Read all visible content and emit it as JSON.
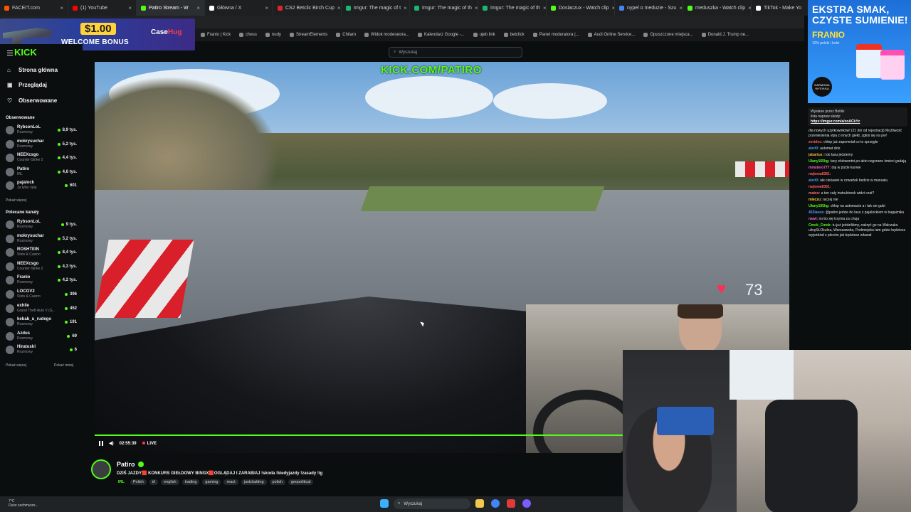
{
  "browser": {
    "tabs": [
      {
        "label": "FACEIT.com",
        "color": "#ff5500"
      },
      {
        "label": "(1) YouTube",
        "color": "#ff0000"
      },
      {
        "label": "Patiro Stream - W",
        "color": "#53fc18",
        "active": true
      },
      {
        "label": "Główna / X",
        "color": "#ffffff"
      },
      {
        "label": "CS2 Betclic Birch Cup",
        "color": "#e0242c"
      },
      {
        "label": "Imgur: The magic of t",
        "color": "#1bb76e"
      },
      {
        "label": "Imgur: The magic of th",
        "color": "#1bb76e"
      },
      {
        "label": "Imgur: The magic of th",
        "color": "#1bb76e"
      },
      {
        "label": "Dosiaczux - Watch clip",
        "color": "#53fc18"
      },
      {
        "label": "nypel o meduzie - Szu",
        "color": "#4285f4"
      },
      {
        "label": "meduszka - Watch clip",
        "color": "#53fc18"
      },
      {
        "label": "TikTok - Make Yo",
        "color": "#ffffff"
      }
    ],
    "bookmarks": [
      "Franio | Kick",
      "chess",
      "nudy",
      "StreamElements",
      "Chilam",
      "Widok moderatora...",
      "Kalendarz Google -...",
      "ujeb link",
      "betclick",
      "Panel moderatora |...",
      "Audi Online Service...",
      "Opuszczone miejsca...",
      "Donald J. Trump ne..."
    ]
  },
  "promo": {
    "amount": "$1.00",
    "text": "WELCOME BONUS",
    "brand_a": "Case",
    "brand_b": "Hug"
  },
  "ad": {
    "headline": "EKSTRA SMAK, CZYSTE SUMIENIE!",
    "brand": "FRANIO",
    "fine_print": "10% polski i lodzi",
    "badge": "DARMOWA WYSYŁKA"
  },
  "kick": {
    "logo": "KICK",
    "search_placeholder": "Wyszukaj"
  },
  "sidebar": {
    "nav": [
      {
        "label": "Strona główna",
        "icon": "⌂"
      },
      {
        "label": "Przeglądaj",
        "icon": "▣"
      },
      {
        "label": "Obserwowane",
        "icon": "♡"
      }
    ],
    "followed_title": "Obserwowane",
    "followed": [
      {
        "name": "RybsonLoL",
        "category": "Rozmowy",
        "viewers": "8,9 tys."
      },
      {
        "name": "mokrysuchar",
        "category": "Rozmowy",
        "viewers": "5,2 tys."
      },
      {
        "name": "NEEXcsgo",
        "category": "Counter-Strike 2",
        "viewers": "4,4 tys."
      },
      {
        "name": "Patiro",
        "category": "IRL",
        "viewers": "4,6 tys."
      },
      {
        "name": "pajalock",
        "category": "Ja tylko śpię",
        "viewers": "601"
      }
    ],
    "show_more": "Pokaż więcej",
    "recommended_title": "Polecane kanały",
    "recommended": [
      {
        "name": "RybsonLoL",
        "category": "Rozmowy",
        "viewers": "9 tys."
      },
      {
        "name": "mokrysuchar",
        "category": "Rozmowy",
        "viewers": "5,2 tys."
      },
      {
        "name": "ROSHTEIN",
        "category": "Slots & Casino",
        "viewers": "8,4 tys."
      },
      {
        "name": "NEEXcsgo",
        "category": "Counter-Strike 2",
        "viewers": "4,3 tys."
      },
      {
        "name": "Franio",
        "category": "Rozmowy",
        "viewers": "4,2 tys."
      },
      {
        "name": "LOCOV2",
        "category": "Slots & Casino",
        "viewers": "396"
      },
      {
        "name": "exhile",
        "category": "Grand Theft Auto V (G...",
        "viewers": "452"
      },
      {
        "name": "kebab_u_rudego",
        "category": "Rozmowy",
        "viewers": "191"
      },
      {
        "name": "Azdus",
        "category": "Rozmowy",
        "viewers": "69"
      },
      {
        "name": "Hiratoshi",
        "category": "Rozmowy",
        "viewers": "6"
      }
    ],
    "show_more_2": "Pokaż więcej",
    "show_less": "Pokaż mniej"
  },
  "player": {
    "watermark": "KICK.COM/PATIRO",
    "heart_rate": "73",
    "time": "02:55:39",
    "live": "LIVE",
    "progress": 0.76
  },
  "stream": {
    "name": "Patiro",
    "title": "DZIŚ JAZDY🟥 KONKURS GIEŁDOWY BINGX🟥OGLĄDAJ I ZARABIAJ !skoda !kiedyjazdy !zasady !ig",
    "category": "IRL",
    "tags": [
      "Polish",
      "irl",
      "english",
      "trading",
      "gaming",
      "react",
      "justchatting",
      "polish",
      "geopolitical"
    ]
  },
  "chat": {
    "pinned_by": "Wysłane przez Botilix",
    "pinned_text": "lista napraw skody:",
    "pinned_link": "https://imgur.com/a/xoACkYc",
    "messages": [
      {
        "user": "",
        "text": "dla nowych użytkowników! (21 dni od rejestracji) Możliwość przeniesienia vipa z innych giełd, zgłoś się na pw!",
        "color": "#dfe2e4"
      },
      {
        "user": "zortdoc:",
        "text": "chłop już zapomniał co to sprzęgło",
        "color": "#ff5c5c"
      },
      {
        "user": "alxri0:",
        "text": "automat dzis",
        "color": "#4aa3ff"
      },
      {
        "user": "jabartus:",
        "text": "i do lasu jedziemy",
        "color": "#ffb347"
      },
      {
        "user": "Ulany165kg:",
        "text": "tacy elokwentni po akto nagrzane śmieci gadają",
        "color": "#53fc18"
      },
      {
        "user": "mmstero777:",
        "text": "daj w pizde kurwie",
        "color": "#ff66cc"
      },
      {
        "user": "najtowa8381:",
        "text": "",
        "color": "#ff5c5c"
      },
      {
        "user": "alxri0:",
        "text": "ale ciekawie w czwartek bedzie w manualu",
        "color": "#4aa3ff"
      },
      {
        "user": "najtowa8381:",
        "text": "",
        "color": "#ff5c5c"
      },
      {
        "user": "mateo:",
        "text": "a ten cały instruktorek widzi czat?",
        "color": "#ff6e6e"
      },
      {
        "user": "mleczu:",
        "text": "raczej nie",
        "color": "#ffd23a"
      },
      {
        "user": "Ulany165kg:",
        "text": "chłop na automacie a i tak sie gubi",
        "color": "#53fc18"
      },
      {
        "user": "453laves:",
        "text": "@patiro jedzie do lasu z pajalockiem w bagażniku",
        "color": "#4aa3ff"
      },
      {
        "user": "nawt:",
        "text": "no bo się trzyma za chuja",
        "color": "#ff66cc"
      },
      {
        "user": "Cmok_Cmok:",
        "text": "tu już jeździliśmy, nakręć go na Walczaka ulicęSŁOkulna, Warszawska, Podmiejska tam gdzie będziesz wyjeżdżał z pleców jak będziesz zdawał",
        "color": "#53fc18"
      }
    ]
  },
  "taskbar": {
    "weather_temp": "7°C",
    "weather_desc": "Duże zachmurze...",
    "search": "Wyszukaj"
  }
}
